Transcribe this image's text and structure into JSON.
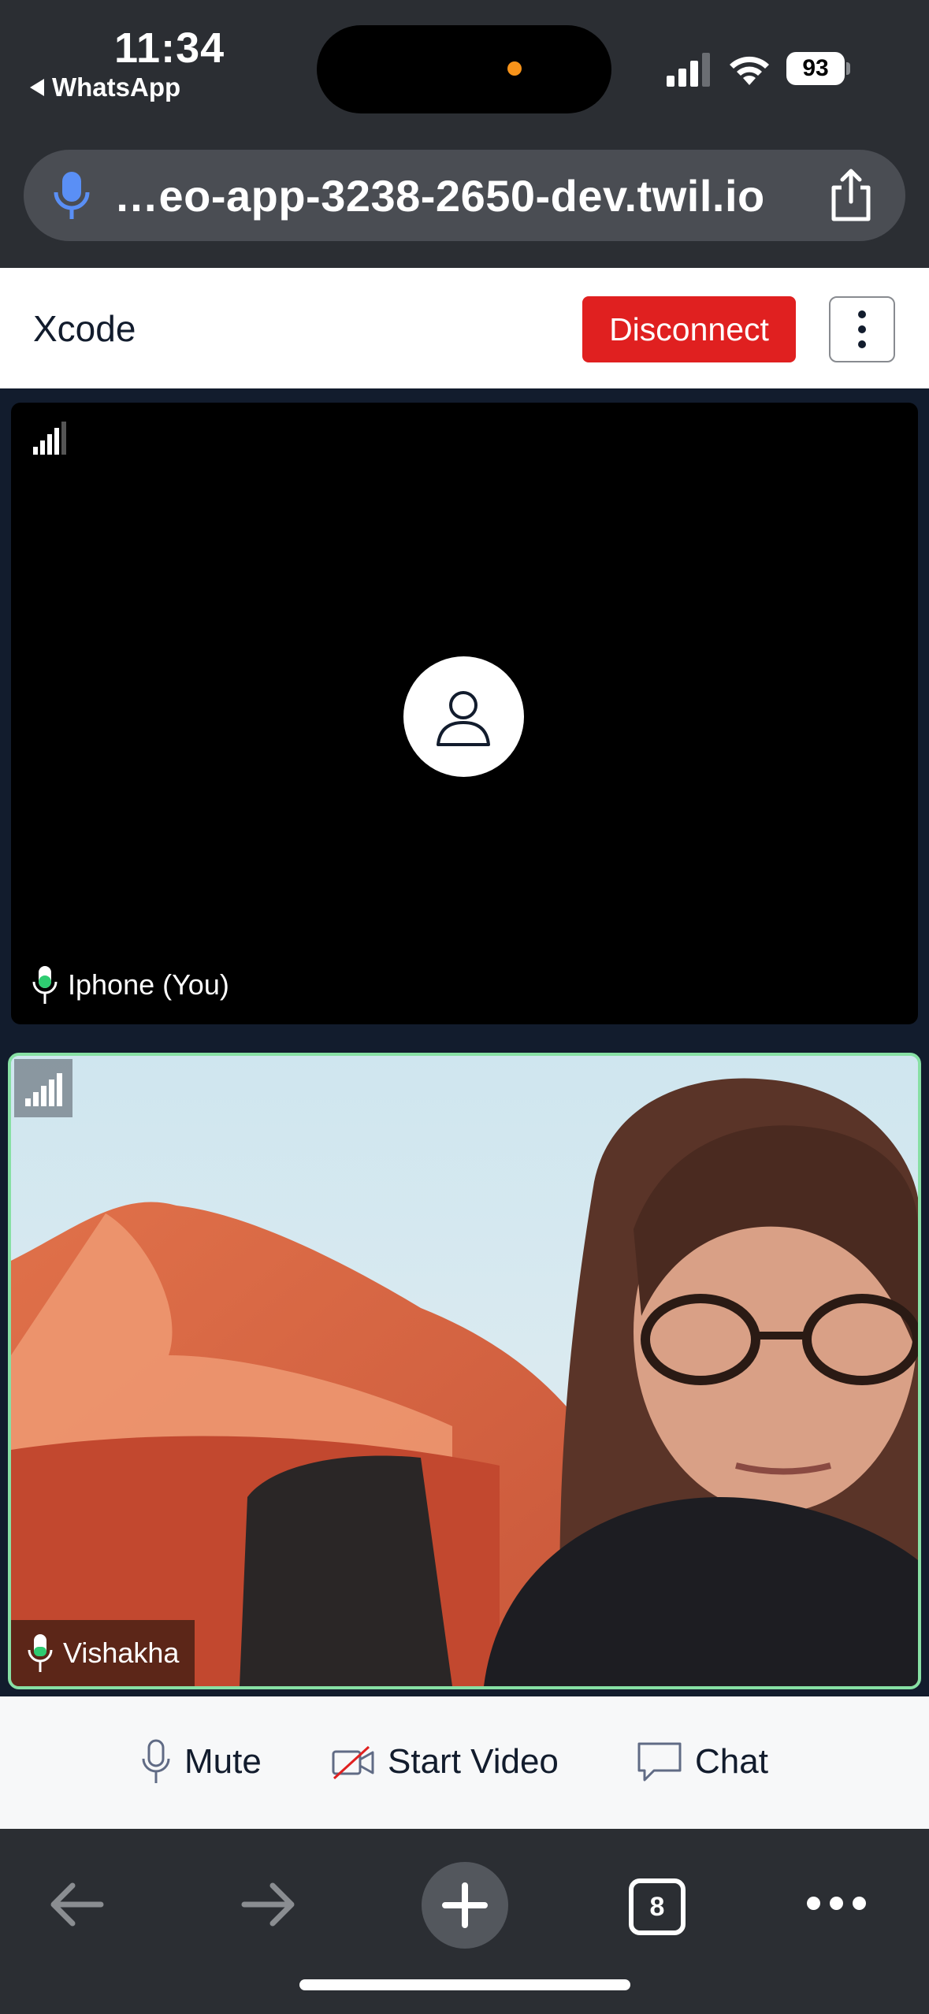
{
  "status_bar": {
    "time": "11:34",
    "back_app": "WhatsApp",
    "battery_level": "93",
    "cellular_bars": 3,
    "wifi": true
  },
  "browser": {
    "url_text": "…eo-app-3238-2650-dev.twil.io",
    "mic_icon": "microphone-icon",
    "share_icon": "share-icon"
  },
  "header": {
    "title": "Xcode",
    "disconnect_label": "Disconnect",
    "menu_icon": "vertical-ellipsis-icon",
    "disconnect_color": "#e02020"
  },
  "participants": [
    {
      "name": "Iphone (You)",
      "video_on": false,
      "network_level": 4,
      "mic_icon": "microphone-icon"
    },
    {
      "name": "Vishakha",
      "video_on": true,
      "network_level": 5,
      "dominant_speaker": true,
      "highlight_color": "#87e0a4"
    }
  ],
  "controls": {
    "mute_label": "Mute",
    "video_label": "Start Video",
    "chat_label": "Chat"
  },
  "toolbar": {
    "tab_count": "8"
  }
}
